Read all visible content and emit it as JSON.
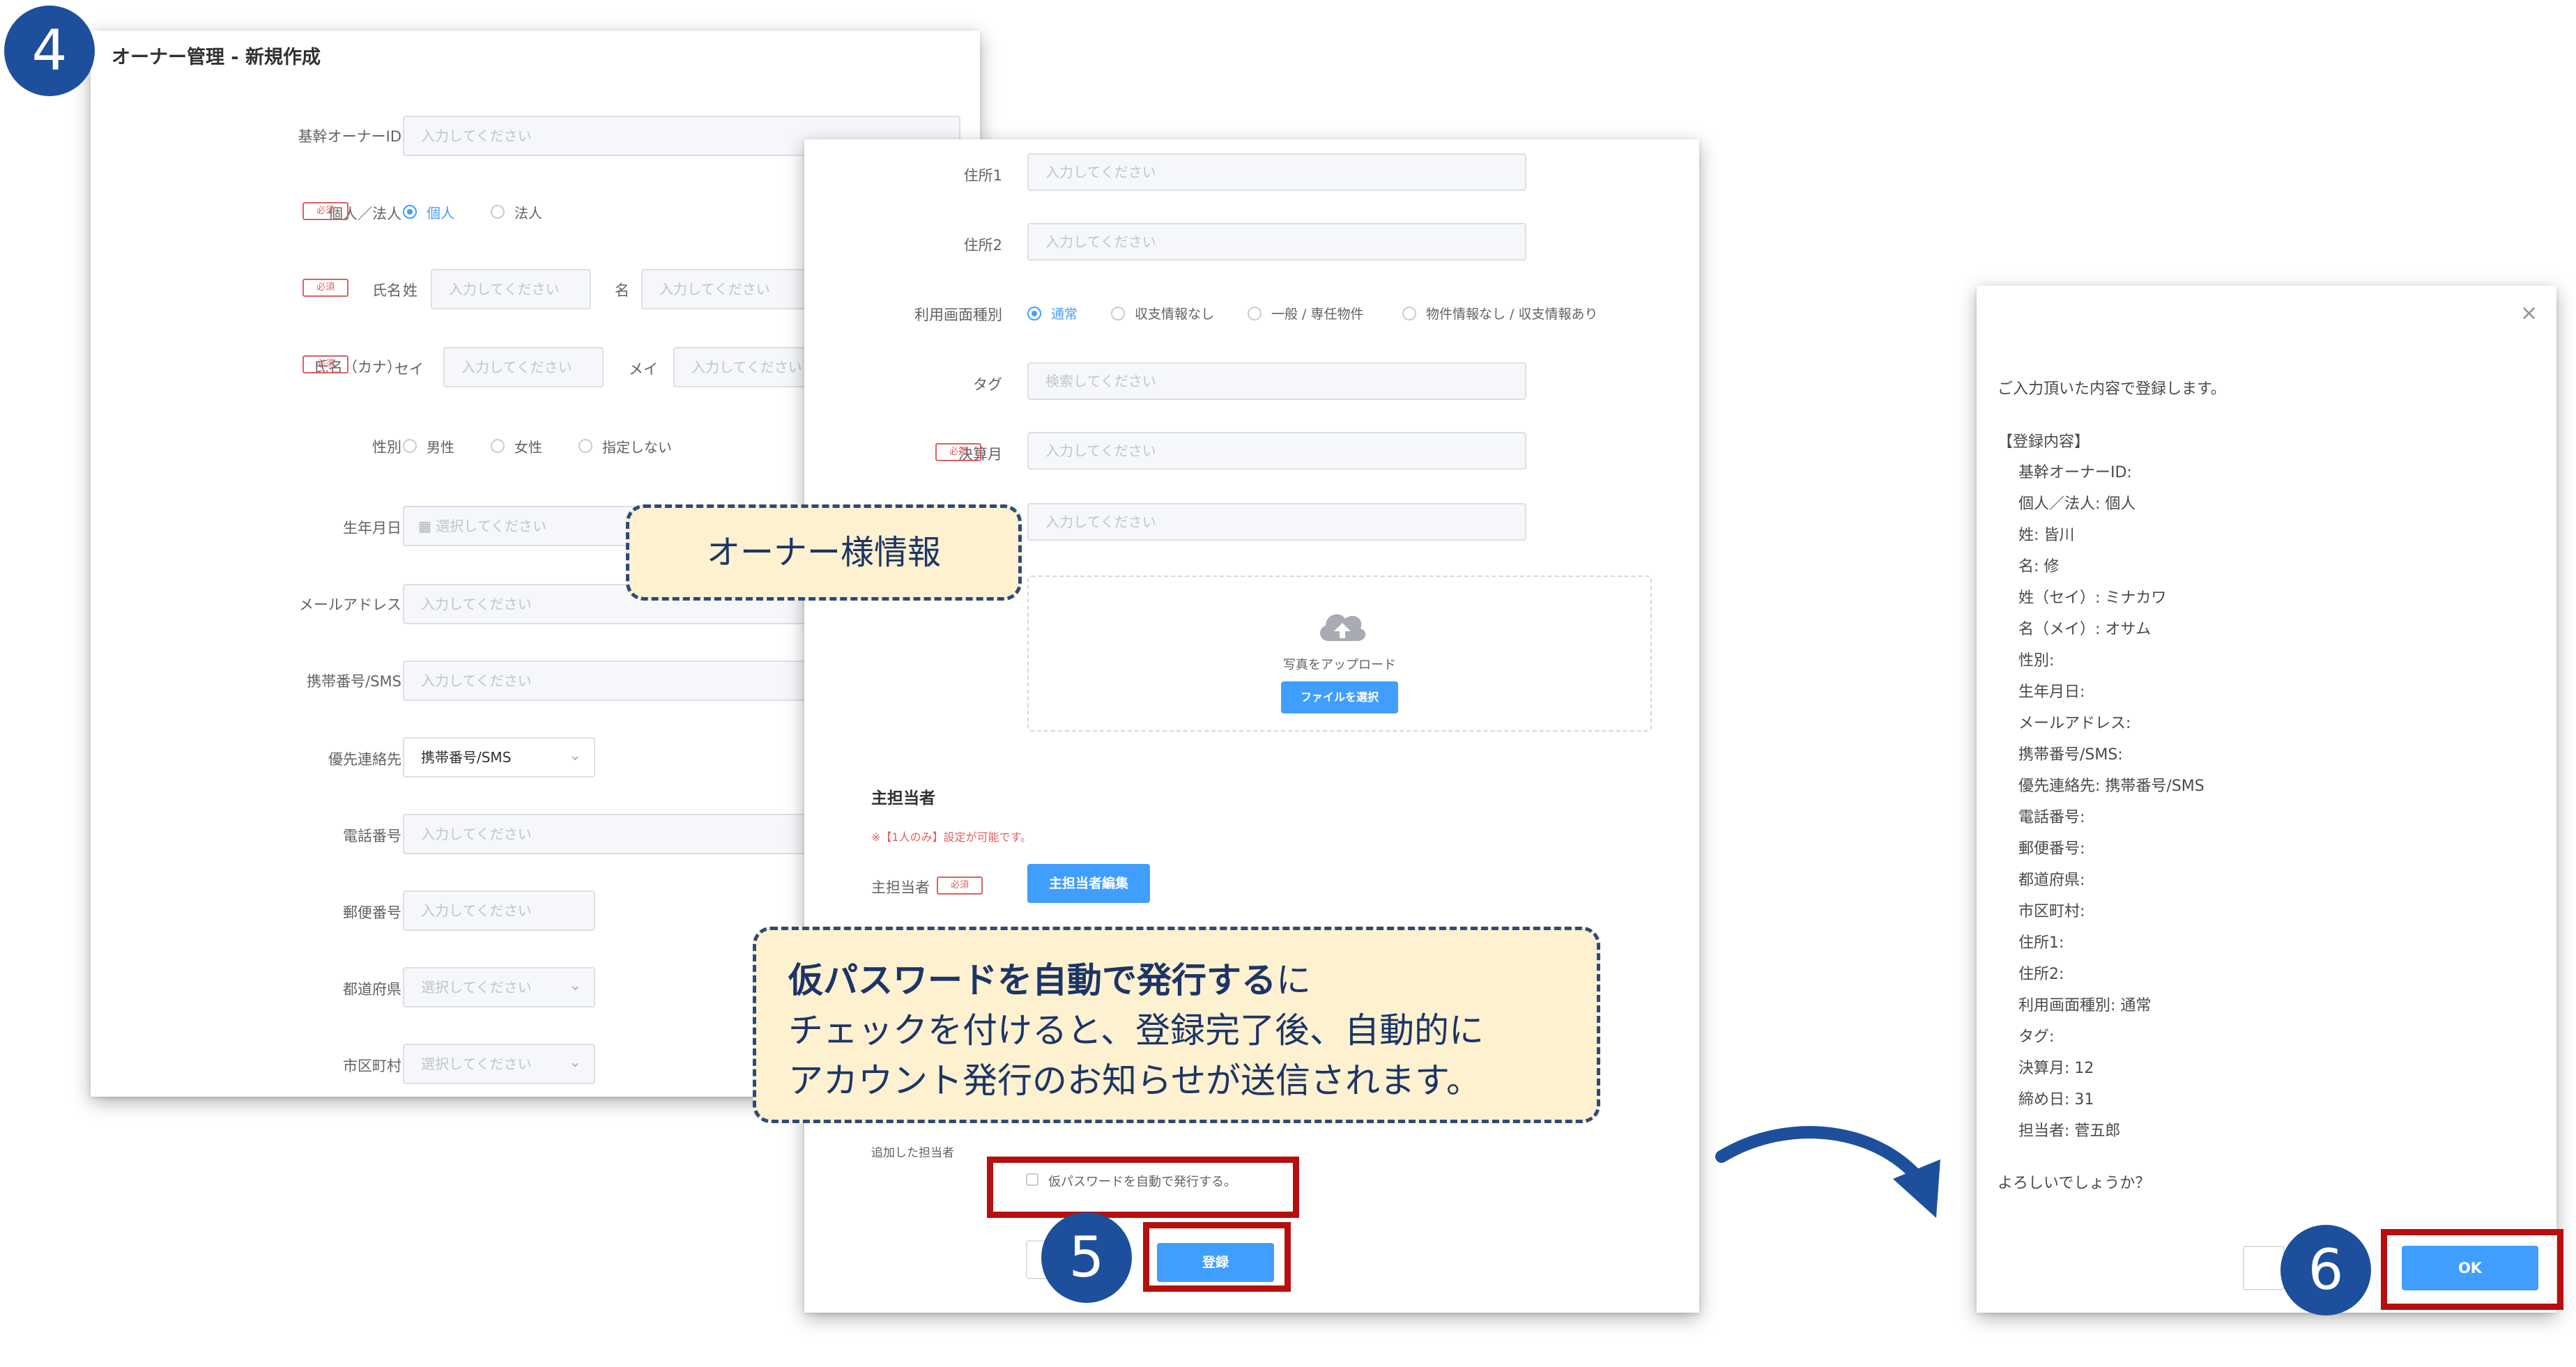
{
  "steps": {
    "step4": "4",
    "step5": "5",
    "step6": "6"
  },
  "colors": {
    "primary": "#409eff",
    "required_red": "#e06060",
    "highlight_red": "#b70f0f",
    "marker_blue": "#1d4f9c",
    "callout_bg": "#fdf1d0"
  },
  "form_left": {
    "title": "オーナー管理 - 新規作成",
    "required_badge": "必須",
    "placeholder_input": "入力してください",
    "placeholder_select": "選択してください",
    "fields": {
      "owner_id": "基幹オーナーID",
      "type": "個人／法人",
      "type_options": [
        "個人",
        "法人"
      ],
      "name": "氏名",
      "last_name_prefix": "姓",
      "first_name_prefix": "名",
      "kana": "氏名（カナ）",
      "kana_last_prefix": "セイ",
      "kana_first_prefix": "メイ",
      "gender": "性別",
      "gender_options": [
        "男性",
        "女性",
        "指定しない"
      ],
      "birthday": "生年月日",
      "email": "メールアドレス",
      "mobile": "携帯番号/SMS",
      "priority_contact": "優先連絡先",
      "priority_contact_value": "携帯番号/SMS",
      "phone": "電話番号",
      "postal": "郵便番号",
      "prefecture": "都道府県",
      "city": "市区町村"
    }
  },
  "form_right": {
    "address1": "住所1",
    "address2": "住所2",
    "screen_type": "利用画面種別",
    "screen_options": [
      "通常",
      "収支情報なし",
      "一般 / 専任物件",
      "物件情報なし / 収支情報あり"
    ],
    "tag": "タグ",
    "tag_placeholder": "検索してください",
    "fiscal_month": "決算月",
    "placeholder_input": "入力してください",
    "upload_label": "写真をアップロード",
    "upload_button": "ファイルを選択",
    "manager_section": "主担当者",
    "manager_note": "※【1人のみ】設定が可能です。",
    "manager_label": "主担当者",
    "manager_button": "主担当者編集",
    "added_manager": "追加した担当者",
    "auto_password_checkbox": "仮パスワードを自動で発行する。",
    "register_button": "登録"
  },
  "callouts": {
    "owner_info": "オーナー様情報",
    "password_line1_bold": "仮パスワードを自動で発行する",
    "password_line1_rest": "に",
    "password_line2": "チェックを付けると、登録完了後、自動的に",
    "password_line3": "アカウント発行のお知らせが送信されます。"
  },
  "dialog": {
    "close_icon": "×",
    "intro": "ご入力頂いた内容で登録します。",
    "section": "【登録内容】",
    "items": [
      "基幹オーナーID:",
      "個人／法人: 個人",
      "姓: 皆川",
      "名: 修",
      "姓（セイ）: ミナカワ",
      "名（メイ）: オサム",
      "性別:",
      "生年月日:",
      "メールアドレス:",
      "携帯番号/SMS:",
      "優先連絡先: 携帯番号/SMS",
      "電話番号:",
      "郵便番号:",
      "都道府県:",
      "市区町村:",
      "住所1:",
      "住所2:",
      "利用画面種別: 通常",
      "タグ:",
      "決算月: 12",
      "締め日: 31",
      "担当者: 菅五郎"
    ],
    "confirm": "よろしいでしょうか？",
    "ok_button": "OK"
  }
}
